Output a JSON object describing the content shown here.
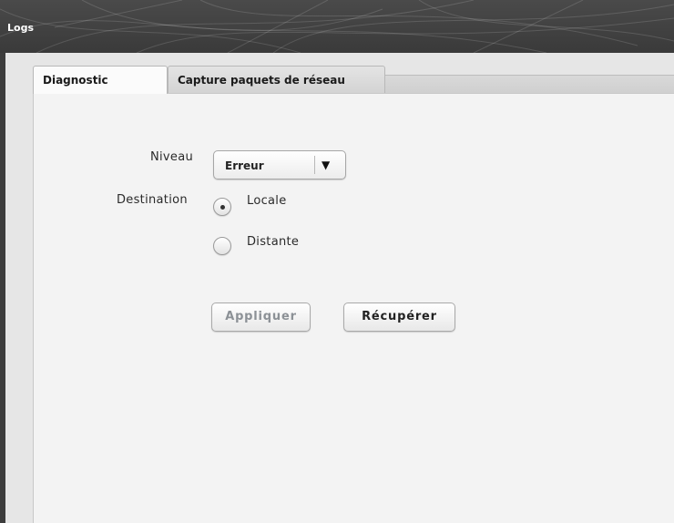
{
  "window": {
    "title": "Logs"
  },
  "tabs": [
    {
      "label": "Diagnostic",
      "active": true
    },
    {
      "label": "Capture paquets de réseau",
      "active": false
    }
  ],
  "form": {
    "level_label": "Niveau",
    "level_value": "Erreur",
    "destination_label": "Destination",
    "destinations": [
      {
        "label": "Locale",
        "selected": true
      },
      {
        "label": "Distante",
        "selected": false
      }
    ]
  },
  "buttons": {
    "apply_label": "Appliquer",
    "retrieve_label": "Récupérer"
  },
  "icons": {
    "dropdown": "chevron-down-icon"
  },
  "colors": {
    "titlebar": "#3f3f3f",
    "panel": "#f3f3f3",
    "disabled_text": "#8c9196"
  }
}
